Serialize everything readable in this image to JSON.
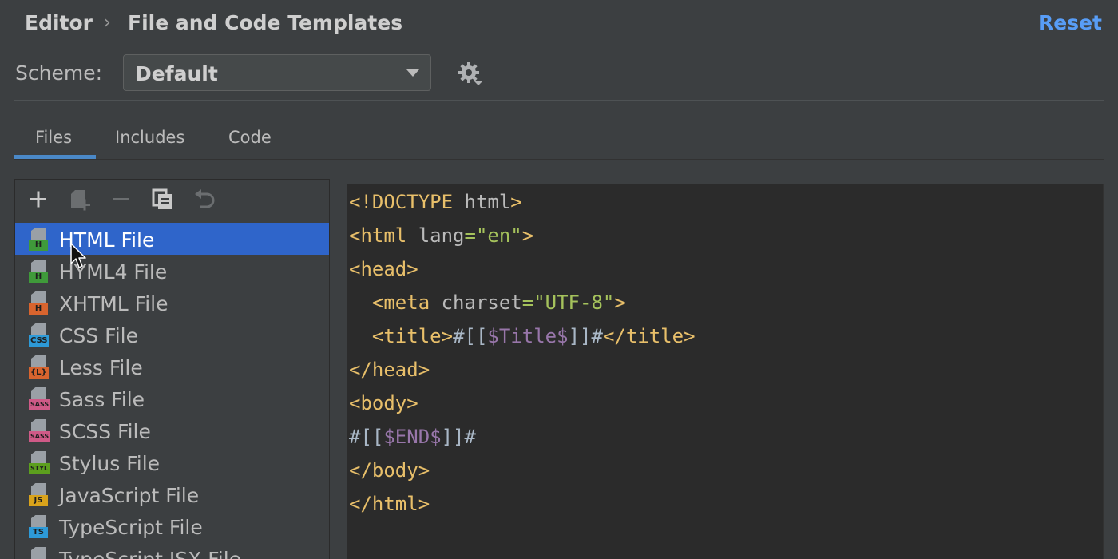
{
  "breadcrumb": {
    "parent": "Editor",
    "separator": "›",
    "current": "File and Code Templates"
  },
  "reset_label": "Reset",
  "scheme": {
    "label": "Scheme:",
    "value": "Default"
  },
  "tabs": [
    {
      "label": "Files",
      "active": true
    },
    {
      "label": "Includes",
      "active": false
    },
    {
      "label": "Code",
      "active": false
    }
  ],
  "toolbar": [
    "add-icon",
    "create-child-icon",
    "remove-icon",
    "copy-icon",
    "reset-icon"
  ],
  "templates": [
    {
      "label": "HTML File",
      "badge": "H",
      "badge_color": "#3f9a3a",
      "selected": true
    },
    {
      "label": "HYML4 File",
      "badge": "H",
      "badge_color": "#3f9a3a",
      "selected": false
    },
    {
      "label": "XHTML File",
      "badge": "H",
      "badge_color": "#d8642e",
      "selected": false
    },
    {
      "label": "CSS File",
      "badge": "CSS",
      "badge_color": "#2d9ad8",
      "selected": false
    },
    {
      "label": "Less File",
      "badge": "{L}",
      "badge_color": "#d8642e",
      "selected": false
    },
    {
      "label": "Sass File",
      "badge": "SASS",
      "badge_color": "#cf5a87",
      "selected": false
    },
    {
      "label": "SCSS File",
      "badge": "SASS",
      "badge_color": "#cf5a87",
      "selected": false
    },
    {
      "label": "Stylus File",
      "badge": "STYL",
      "badge_color": "#5c9f1e",
      "selected": false
    },
    {
      "label": "JavaScript File",
      "badge": "JS",
      "badge_color": "#d9a31b",
      "selected": false
    },
    {
      "label": "TypeScript File",
      "badge": "TS",
      "badge_color": "#2d9ad8",
      "selected": false
    },
    {
      "label": "TypeScript JSX File",
      "badge": "TS",
      "badge_color": "#2d9ad8",
      "selected": false
    }
  ],
  "code": {
    "l1_tag": "<!DOCTYPE",
    "l1_attr": " html",
    "l1_close": ">",
    "l2_open": "<html",
    "l2_attr": " lang",
    "l2_eq": "=",
    "l2_val": "\"en\"",
    "l2_close": ">",
    "l3": "<head>",
    "l4_indent": "  ",
    "l4_open": "<meta",
    "l4_attr": " charset",
    "l4_eq": "=",
    "l4_val": "\"UTF-8\"",
    "l4_close": ">",
    "l5_indent": "  ",
    "l5_open": "<title>",
    "l5_pre": "#[[",
    "l5_var": "$Title$",
    "l5_post": "]]#",
    "l5_close": "</title>",
    "l6": "</head>",
    "l7": "<body>",
    "l8_pre": "#[[",
    "l8_var": "$END$",
    "l8_post": "]]#",
    "l9": "</body>",
    "l10": "</html>"
  }
}
